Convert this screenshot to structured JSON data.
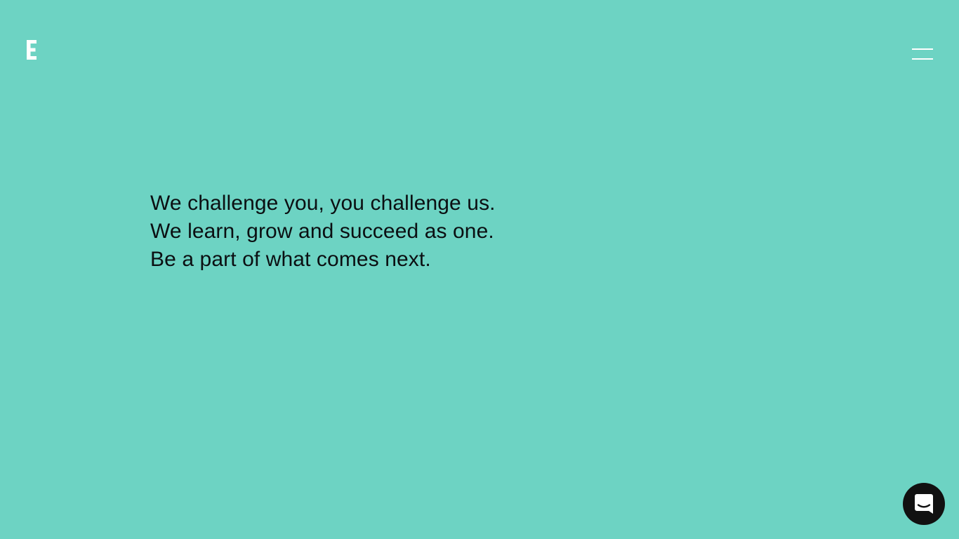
{
  "header": {
    "logo_icon": "letter-e-logo-icon",
    "logo_text": "E",
    "menu_icon": "hamburger-menu-icon"
  },
  "hero": {
    "lines": [
      "We challenge you, you challenge us.",
      "We learn, grow and succeed as one.",
      "Be a part of what comes next."
    ]
  },
  "chat_launcher": {
    "icon": "chat-bubble-icon"
  },
  "colors": {
    "background": "#6dd3c3",
    "text": "#0b0f12",
    "logo": "#ffffff",
    "menu_lines": "#ffffff",
    "chat_button": "#111111"
  }
}
